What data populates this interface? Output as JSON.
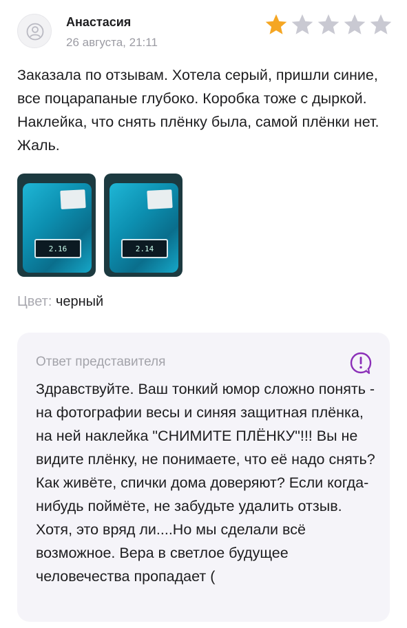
{
  "review": {
    "author": "Анастасия",
    "date": "26 августа, 21:11",
    "rating": 1,
    "max_rating": 5,
    "star_color_active": "#F5A623",
    "star_color_inactive": "#C9C9D2",
    "text": "Заказала по отзывам. Хотела серый, пришли синие, все поцарапаные глубоко. Коробка тоже с дыркой. Наклейка, что снять плёнку была, самой плёнки нет. Жаль.",
    "photos": [
      {
        "display": "2.16"
      },
      {
        "display": "2.14"
      }
    ],
    "color_label": "Цвет:",
    "color_value": "черный"
  },
  "answer": {
    "title": "Ответ представителя",
    "icon": "exclamation-circle-icon",
    "accent": "#8B2FB8",
    "text": "Здравствуйте. Ваш тонкий юмор сложно понять - на фотографии весы и  синяя защитная плёнка, на ней наклейка \"СНИМИТЕ ПЛЁНКУ\"!!! Вы не видите плёнку, не понимаете, что её надо снять? Как живёте, спички дома доверяют? Если когда-нибудь поймёте, не забудьте удалить отзыв. Хотя, это вряд ли....Но мы сделали всё возможное. Вера в светлое будущее человечества пропадает ("
  }
}
